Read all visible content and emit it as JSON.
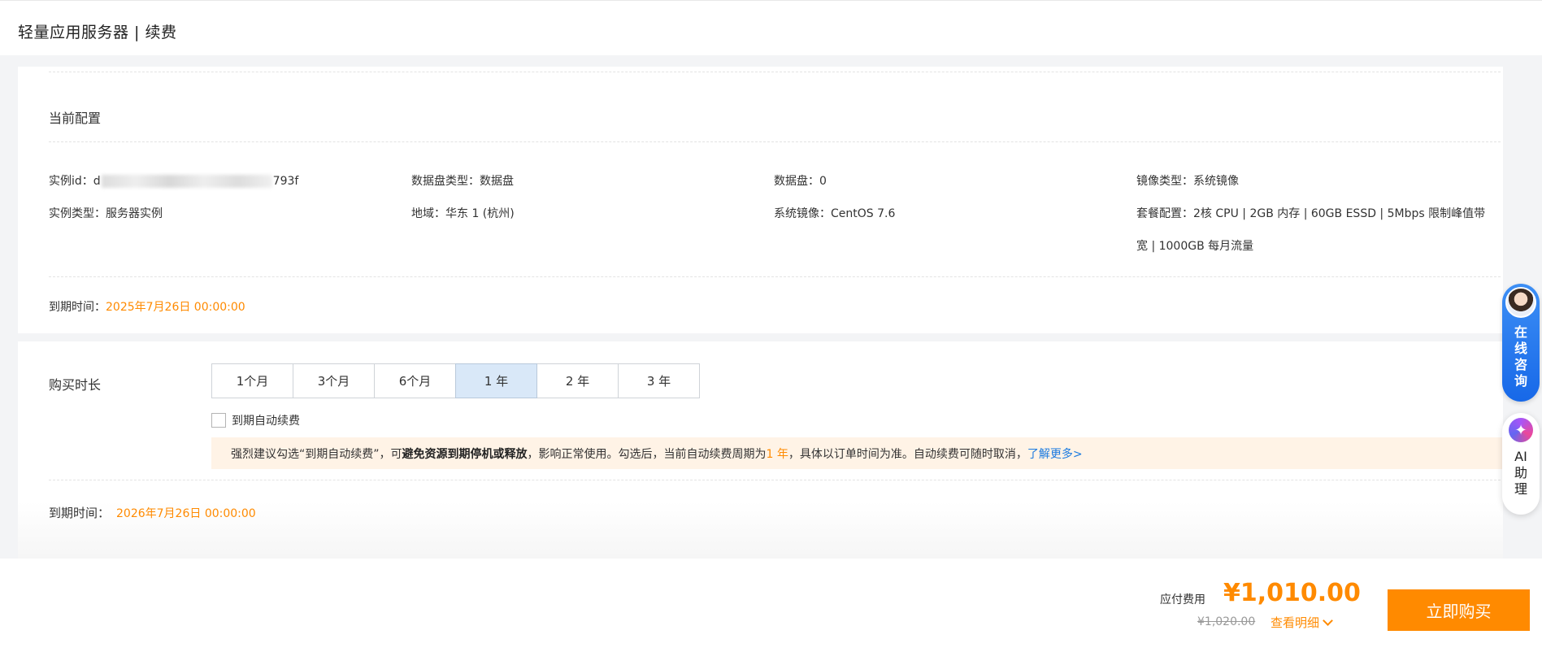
{
  "page": {
    "title": "轻量应用服务器 | 续费"
  },
  "current_config": {
    "title": "当前配置",
    "instance_id_label": "实例id：",
    "instance_id_prefix": "d",
    "instance_id_suffix": "793f",
    "data_disk_type_label": "数据盘类型：",
    "data_disk_type": "数据盘",
    "data_disk_label": "数据盘：",
    "data_disk": "0",
    "image_type_label": "镜像类型：",
    "image_type": "系统镜像",
    "instance_type_label": "实例类型：",
    "instance_type": "服务器实例",
    "region_label": "地域：",
    "region": "华东 1 (杭州)",
    "system_image_label": "系统镜像：",
    "system_image": "CentOS 7.6",
    "package_label": "套餐配置：",
    "package_line1": "2核 CPU | 2GB 内存 | 60GB ESSD | 5Mbps 限制峰值带",
    "package_line2": "宽 | 1000GB 每月流量",
    "expire_label": "到期时间：",
    "expire": "2025年7月26日 00:00:00"
  },
  "purchase": {
    "duration_label": "购买时长",
    "durations": [
      "1个月",
      "3个月",
      "6个月",
      "1 年",
      "2 年",
      "3 年"
    ],
    "selected": "1 年",
    "auto_renew_label": "到期自动续费",
    "notice": {
      "part1": "强烈建议勾选“到期自动续费”，可",
      "bold": "避免资源到期停机或释放",
      "part2": "，影响正常使用。勾选后，当前自动续费周期为 ",
      "period": "1 年",
      "part3": "，具体以订单时间为准。自动续费可随时取消，",
      "link": "了解更多>"
    },
    "expire_label": "到期时间：",
    "expire": "2026年7月26日 00:00:00"
  },
  "footer": {
    "pay_label": "应付费用",
    "price": "¥1,010.00",
    "original_price": "¥1,020.00",
    "detail_link": "查看明细",
    "buy_button": "立即购买"
  },
  "floating": {
    "consult": "在线咨询",
    "ai": "AI助理"
  },
  "colors": {
    "accent": "#ff8a00",
    "selected": "#d9e8f8",
    "link": "#1a7ae0"
  }
}
